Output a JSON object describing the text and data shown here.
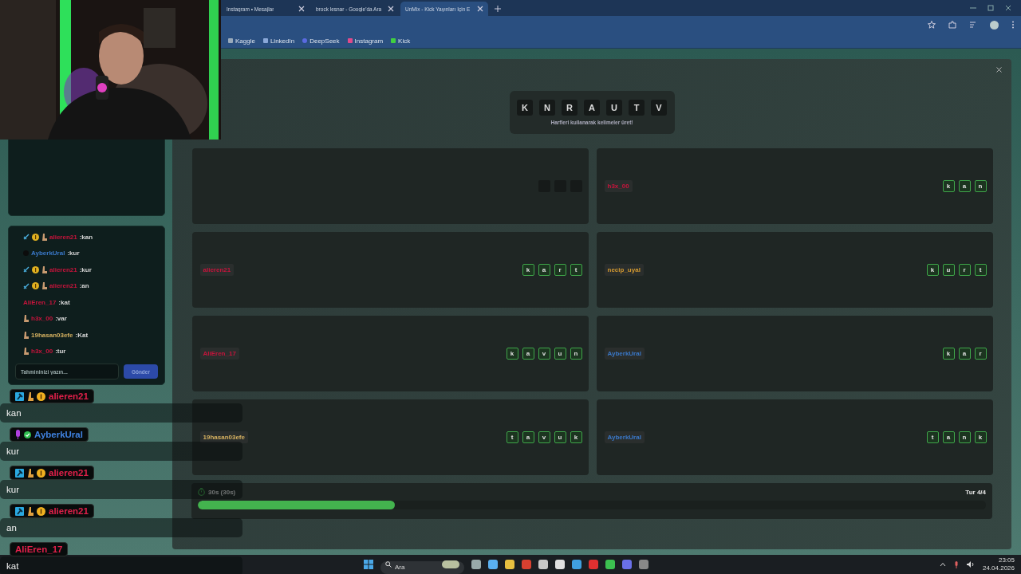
{
  "browser": {
    "tabs": [
      {
        "title": "Instagram • Mesajlar",
        "selected": false
      },
      {
        "title": "brock lesnar - Google'da Ara",
        "selected": false
      },
      {
        "title": "UnMix - Kick Yayınları İçin E",
        "selected": true
      }
    ],
    "bookmarks": [
      "Kaggle",
      "LinkedIn",
      "DeepSeek",
      "Instagram",
      "Kick"
    ]
  },
  "sidebar": {
    "guesses": [
      {
        "name": "alieren21",
        "color": "#c8143c",
        "text": ":kan",
        "badges": [
          {
            "kind": "sword"
          },
          {
            "kind": "coin"
          },
          {
            "kind": "boot"
          }
        ]
      },
      {
        "name": "AyberkUral",
        "color": "#3a78c8",
        "text": ":kur",
        "badges": [
          {
            "kind": "dot"
          }
        ]
      },
      {
        "name": "alieren21",
        "color": "#c8143c",
        "text": ":kur",
        "badges": [
          {
            "kind": "sword"
          },
          {
            "kind": "coin"
          },
          {
            "kind": "boot"
          }
        ]
      },
      {
        "name": "alieren21",
        "color": "#c8143c",
        "text": ":an",
        "badges": [
          {
            "kind": "sword"
          },
          {
            "kind": "coin"
          },
          {
            "kind": "boot"
          }
        ]
      },
      {
        "name": "AliEren_17",
        "color": "#c8143c",
        "text": ":kat"
      },
      {
        "name": "h3x_00",
        "color": "#c8143c",
        "text": ":var",
        "badges": [
          {
            "kind": "boot"
          }
        ]
      },
      {
        "name": "19hasan03efe",
        "color": "#d4b060",
        "text": ":Kat",
        "badges": [
          {
            "kind": "boot"
          }
        ]
      },
      {
        "name": "h3x_00",
        "color": "#c8143c",
        "text": ":tur",
        "badges": [
          {
            "kind": "boot"
          }
        ]
      }
    ],
    "input": {
      "placeholder": "Tahmininizi yazın..."
    },
    "send_button": "Gönder"
  },
  "game": {
    "letters": [
      "K",
      "N",
      "R",
      "A",
      "U",
      "T",
      "V"
    ],
    "hint": "Harfleri kullanarak kelimeler üret!",
    "cards": [
      {
        "kind": "pending",
        "slots": [
          {
            "filled": false
          },
          {
            "filled": false
          },
          {
            "filled": false
          }
        ]
      },
      {
        "kind": "word",
        "player": "h3x_00",
        "color": "#c8143c",
        "letters": [
          "k",
          "a",
          "n"
        ]
      },
      {
        "kind": "word",
        "player": "alieren21",
        "color": "#c8143c",
        "letters": [
          "k",
          "a",
          "r",
          "t"
        ]
      },
      {
        "kind": "word",
        "player": "necip_uyal",
        "color": "#d49a30",
        "letters": [
          "k",
          "u",
          "r",
          "t"
        ]
      },
      {
        "kind": "word",
        "player": "AliEren_17",
        "color": "#c8143c",
        "letters": [
          "k",
          "a",
          "v",
          "u",
          "n"
        ]
      },
      {
        "kind": "word",
        "player": "AyberkUral",
        "color": "#3a78c8",
        "letters": [
          "k",
          "a",
          "r"
        ]
      },
      {
        "kind": "word",
        "player": "19hasan03efe",
        "color": "#d4b060",
        "letters": [
          "t",
          "a",
          "v",
          "u",
          "k"
        ]
      },
      {
        "kind": "word",
        "player": "AyberkUral",
        "color": "#3a78c8",
        "letters": [
          "t",
          "a",
          "n",
          "k"
        ]
      }
    ],
    "timer": "30s (30s)",
    "round": "Tur 4/4",
    "progress": {
      "level": 0.25
    }
  },
  "chat": [
    {
      "name": "alieren21",
      "color": "#e0204a",
      "text": "kan",
      "badges": [
        {
          "kind": "hammer"
        },
        {
          "kind": "boot"
        },
        {
          "kind": "coin"
        }
      ]
    },
    {
      "name": "AyberkUral",
      "color": "#3f82e0",
      "text": "kur",
      "badges": [
        {
          "kind": "mic"
        },
        {
          "kind": "check"
        }
      ]
    },
    {
      "name": "alieren21",
      "color": "#e0204a",
      "text": "kur",
      "badges": [
        {
          "kind": "hammer"
        },
        {
          "kind": "boot"
        },
        {
          "kind": "coin"
        }
      ]
    },
    {
      "name": "alieren21",
      "color": "#e0204a",
      "text": "an",
      "badges": [
        {
          "kind": "hammer"
        },
        {
          "kind": "boot"
        },
        {
          "kind": "coin"
        }
      ]
    },
    {
      "name": "AliEren_17",
      "color": "#e0204a",
      "text": "kat"
    }
  ],
  "taskbar": {
    "search": {
      "placeholder": "Ara"
    },
    "time": "23:05",
    "date": "24.04.2026"
  }
}
